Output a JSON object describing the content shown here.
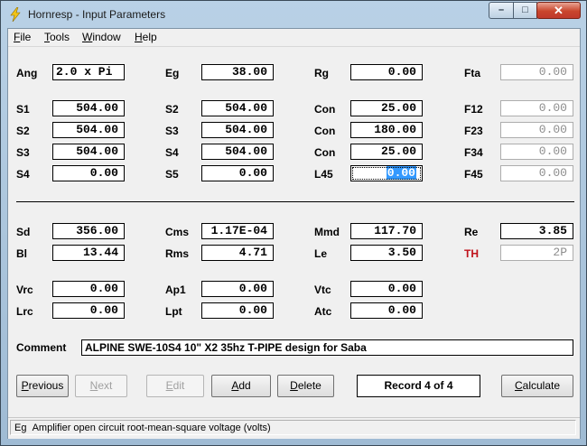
{
  "window": {
    "title": "Hornresp - Input Parameters",
    "min_symbol": "–",
    "max_symbol": "□",
    "close_symbol": "✕"
  },
  "menu": [
    {
      "accel": "F",
      "rest": "ile"
    },
    {
      "accel": "T",
      "rest": "ools"
    },
    {
      "accel": "W",
      "rest": "indow"
    },
    {
      "accel": "H",
      "rest": "elp"
    }
  ],
  "params": {
    "ang": {
      "label": "Ang",
      "value": "2.0 x Pi"
    },
    "eg": {
      "label": "Eg",
      "value": "38.00"
    },
    "rg": {
      "label": "Rg",
      "value": "0.00"
    },
    "fta": {
      "label": "Fta",
      "value": "0.00"
    },
    "s1": {
      "label": "S1",
      "value": "504.00"
    },
    "s2a": {
      "label": "S2",
      "value": "504.00"
    },
    "s2b": {
      "label": "S2",
      "value": "504.00"
    },
    "s3a": {
      "label": "S3",
      "value": "504.00"
    },
    "s3b": {
      "label": "S3",
      "value": "504.00"
    },
    "s4a": {
      "label": "S4",
      "value": "504.00"
    },
    "s4b": {
      "label": "S4",
      "value": "0.00"
    },
    "s5": {
      "label": "S5",
      "value": "0.00"
    },
    "con1": {
      "label": "Con",
      "value": "25.00"
    },
    "con2": {
      "label": "Con",
      "value": "180.00"
    },
    "con3": {
      "label": "Con",
      "value": "25.00"
    },
    "l45": {
      "label": "L45",
      "value": "0.00"
    },
    "f12": {
      "label": "F12",
      "value": "0.00"
    },
    "f23": {
      "label": "F23",
      "value": "0.00"
    },
    "f34": {
      "label": "F34",
      "value": "0.00"
    },
    "f45": {
      "label": "F45",
      "value": "0.00"
    },
    "sd": {
      "label": "Sd",
      "value": "356.00"
    },
    "bl": {
      "label": "Bl",
      "value": "13.44"
    },
    "cms": {
      "label": "Cms",
      "value": "1.17E-04"
    },
    "rms": {
      "label": "Rms",
      "value": "4.71"
    },
    "mmd": {
      "label": "Mmd",
      "value": "117.70"
    },
    "le": {
      "label": "Le",
      "value": "3.50"
    },
    "re": {
      "label": "Re",
      "value": "3.85"
    },
    "th": {
      "label": "TH",
      "value": "2P"
    },
    "vrc": {
      "label": "Vrc",
      "value": "0.00"
    },
    "lrc": {
      "label": "Lrc",
      "value": "0.00"
    },
    "ap1": {
      "label": "Ap1",
      "value": "0.00"
    },
    "lpt": {
      "label": "Lpt",
      "value": "0.00"
    },
    "vtc": {
      "label": "Vtc",
      "value": "0.00"
    },
    "atc": {
      "label": "Atc",
      "value": "0.00"
    }
  },
  "comment": {
    "label": "Comment",
    "value": "ALPINE SWE-10S4 10\" X2 35hz T-PIPE design for Saba"
  },
  "buttons": {
    "previous": {
      "accel": "P",
      "rest": "revious"
    },
    "next": {
      "accel": "N",
      "rest": "ext"
    },
    "edit": {
      "accel": "E",
      "rest": "dit"
    },
    "add": {
      "accel": "A",
      "rest": "dd"
    },
    "delete": {
      "accel": "D",
      "rest": "elete"
    },
    "calculate": {
      "accel": "C",
      "rest": "alculate"
    }
  },
  "record": "Record 4 of 4",
  "status": {
    "code": "Eg",
    "text": "Amplifier open circuit root-mean-square voltage  (volts)"
  },
  "colors": {
    "th_label": "#c0121b",
    "selection": "#3399ff"
  }
}
